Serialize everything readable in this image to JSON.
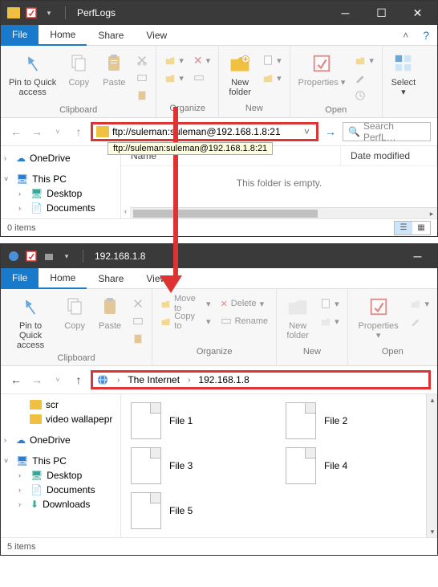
{
  "win1": {
    "title": "PerfLogs",
    "tabs": {
      "file": "File",
      "home": "Home",
      "share": "Share",
      "view": "View"
    },
    "ribbon": {
      "pin": "Pin to Quick\naccess",
      "copy": "Copy",
      "paste": "Paste",
      "clipboard_label": "Clipboard",
      "organize_label": "Organize",
      "newfolder": "New\nfolder",
      "new_label": "New",
      "properties": "Properties",
      "open_label": "Open",
      "select": "Select"
    },
    "address": "ftp://suleman:suleman@192.168.1.8:21",
    "hint": "ftp://suleman:suleman@192.168.1.8:21",
    "search_placeholder": "Search PerfL…",
    "cols": {
      "name": "Name",
      "date": "Date modified"
    },
    "empty": "This folder is empty.",
    "tree": {
      "onedrive": "OneDrive",
      "thispc": "This PC",
      "desktop": "Desktop",
      "documents": "Documents"
    },
    "status": "0 items"
  },
  "win2": {
    "title": "192.168.1.8",
    "tabs": {
      "file": "File",
      "home": "Home",
      "share": "Share",
      "view": "View"
    },
    "ribbon": {
      "pin": "Pin to Quick\naccess",
      "copy": "Copy",
      "paste": "Paste",
      "clipboard_label": "Clipboard",
      "moveto": "Move to",
      "copyto": "Copy to",
      "delete": "Delete",
      "rename": "Rename",
      "organize_label": "Organize",
      "newfolder": "New\nfolder",
      "new_label": "New",
      "properties": "Properties",
      "open_label": "Open"
    },
    "breadcrumb": {
      "root": "The Internet",
      "loc": "192.168.1.8"
    },
    "tree": {
      "scr": "scr",
      "video": "video wallapepr",
      "onedrive": "OneDrive",
      "thispc": "This PC",
      "desktop": "Desktop",
      "documents": "Documents",
      "downloads": "Downloads"
    },
    "files": [
      "File 1",
      "File 2",
      "File 3",
      "File 4",
      "File 5"
    ],
    "status": "5 items"
  }
}
